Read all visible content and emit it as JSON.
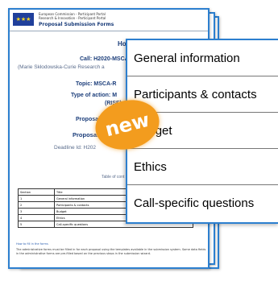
{
  "document": {
    "header": {
      "line1": "European Commission - Participant Portal",
      "line2": "Research & Innovation - Participant Portal",
      "title": "Proposal Submission Forms",
      "flag_icon": "eu-flag-icon"
    },
    "programme": "Horizon 20",
    "call": "Call: H2020-MSCA",
    "call_sub": "(Marie Skłodowska-Curie Research a",
    "topic": "Topic: MSCA-R",
    "type_of_action": "Type of action: M",
    "type_of_action_sub": "(RISE)",
    "proposal_number": "Proposal n",
    "proposal_acronym": "Proposal a",
    "deadline": "Deadline Id: H202",
    "table_of_contents": "Table of cont",
    "table": {
      "headers": [
        "Section",
        "Title"
      ],
      "rows": [
        [
          "1",
          "General information"
        ],
        [
          "2",
          "Participants & contacts"
        ],
        [
          "3",
          "Budget"
        ],
        [
          "4",
          "Ethics"
        ],
        [
          "5",
          "Call-specific questions"
        ]
      ]
    },
    "footer_link": "How to fill in the forms",
    "footer_text": "The administrative forms must be filled in for each proposal using the templates available in the submission system. Some data fields in the administrative forms are pre-filled based on the previous steps in the submission wizard."
  },
  "panel": {
    "items": [
      "General information",
      "Participants & contacts",
      "Budget",
      "Ethics",
      "Call-specific questions"
    ]
  },
  "badge": {
    "label": "new",
    "color": "#f39c1e"
  },
  "colors": {
    "border": "#2c7fcf",
    "title_blue": "#1b3d7a"
  }
}
